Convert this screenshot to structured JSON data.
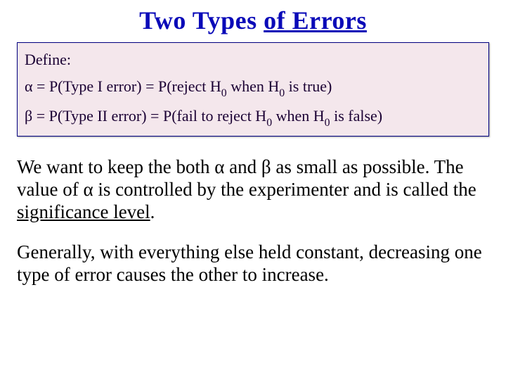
{
  "title": {
    "pre": "Two Types ",
    "uline": "of Errors"
  },
  "box": {
    "define_label": "Define:",
    "alpha_line": {
      "sym": "α",
      "eq": " = P(Type I error) = P(reject H",
      "sub1": "0",
      "mid": " when H",
      "sub2": "0",
      "end": " is true)"
    },
    "beta_line": {
      "sym": "β =",
      "eq": " P(Type II error) = P(fail to reject H",
      "sub1": "0",
      "mid": " when H",
      "sub2": "0",
      "end": " is false)"
    }
  },
  "body": {
    "p1": {
      "t1": "We want to keep the both ",
      "a": "α",
      "t2": " and ",
      "b": "β",
      "t3": " as small as possible. The value of ",
      "a2": "α",
      "t4": " is controlled by the experimenter and is called the ",
      "ul": "significance level",
      "t5": "."
    },
    "p2": "Generally, with everything else held constant, decreasing one type of error causes the other to increase."
  }
}
